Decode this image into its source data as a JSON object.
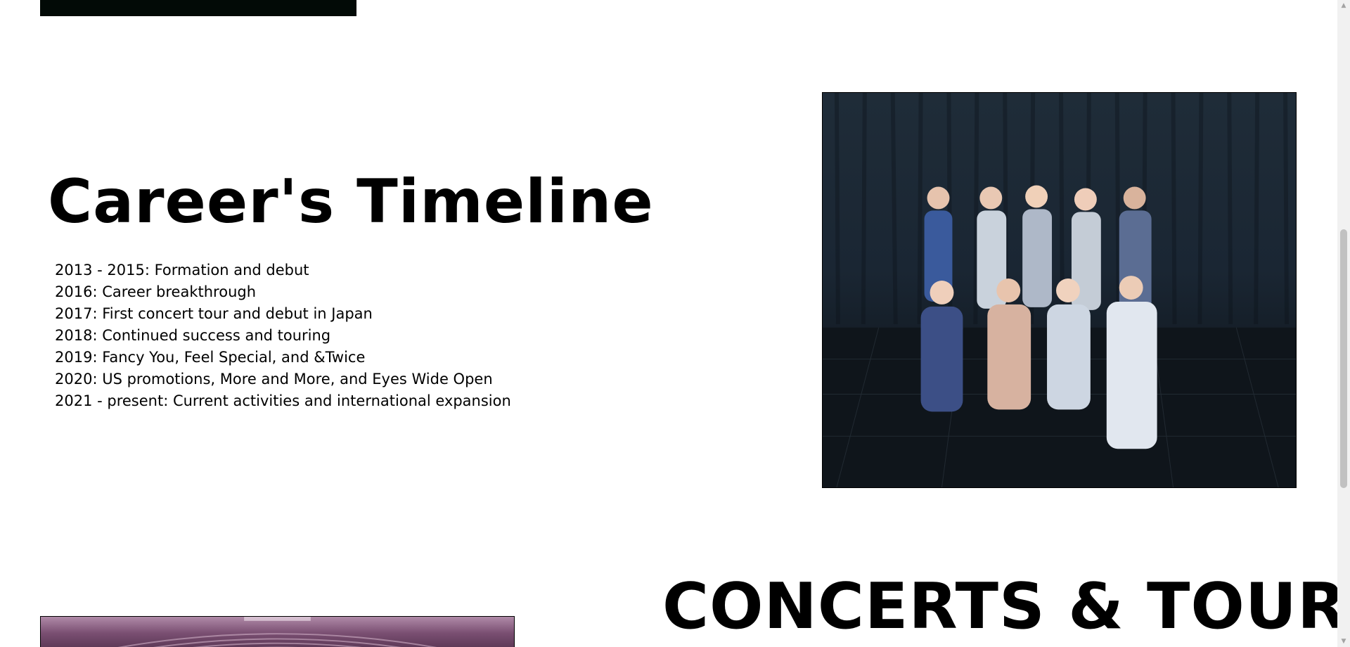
{
  "timeline": {
    "title": "Career's Timeline",
    "items": [
      "2013 - 2015: Formation and debut",
      "2016: Career breakthrough",
      "2017: First concert tour and debut in Japan",
      "2018: Continued success and touring",
      "2019: Fancy You, Feel Special, and &Twice",
      "2020: US promotions, More and More, and Eyes Wide Open",
      "2021 - present: Current activities and international expansion"
    ]
  },
  "concerts": {
    "title": "CONCERTS & TOURS"
  },
  "scrollbar": {
    "up_arrow": "▲",
    "down_arrow": "▼"
  }
}
